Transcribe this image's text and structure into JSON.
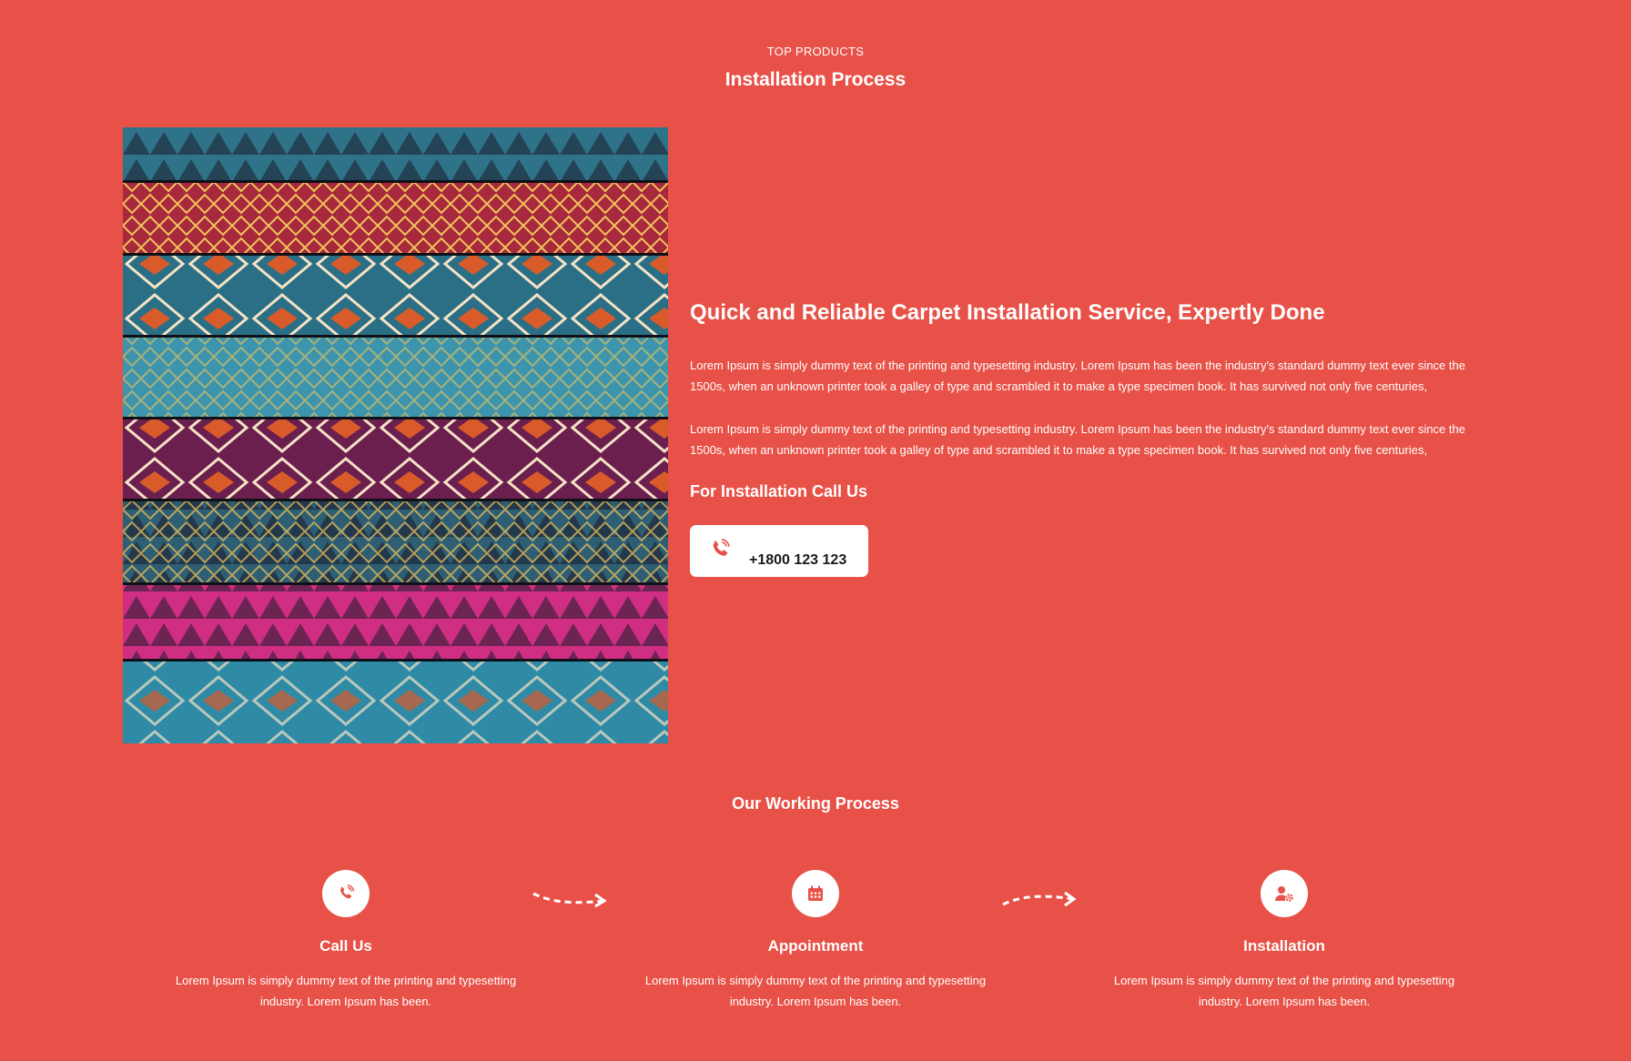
{
  "header": {
    "eyebrow": "TOP PRODUCTS",
    "title": "Installation Process"
  },
  "hero": {
    "image_alt": "stack of colorful patterned carpets",
    "headline": "Quick and Reliable Carpet Installation Service, Expertly Done",
    "paragraphs": [
      "Lorem Ipsum is simply dummy text of the printing and typesetting industry. Lorem Ipsum has been the industry's standard dummy text ever since the 1500s, when an unknown printer took a galley of type and scrambled it to make a type specimen book. It has survived not only five centuries,",
      "Lorem Ipsum is simply dummy text of the printing and typesetting industry. Lorem Ipsum has been the industry's standard dummy text ever since the 1500s, when an unknown printer took a galley of type and scrambled it to make a type specimen book. It has survived not only five centuries,"
    ],
    "call_title": "For Installation Call Us",
    "phone": "+1800 123 123",
    "phone_icon": "phone-icon"
  },
  "process": {
    "title": "Our Working Process",
    "steps": [
      {
        "icon": "phone-icon",
        "label": "Call Us",
        "desc": "Lorem Ipsum is simply dummy text of the printing and typesetting industry. Lorem Ipsum has been."
      },
      {
        "icon": "calendar-icon",
        "label": "Appointment",
        "desc": "Lorem Ipsum is simply dummy text of the printing and typesetting industry. Lorem Ipsum has been."
      },
      {
        "icon": "user-gear-icon",
        "label": "Installation",
        "desc": "Lorem Ipsum is simply dummy text of the printing and typesetting industry. Lorem Ipsum has been."
      }
    ]
  },
  "colors": {
    "background": "#e85147",
    "text": "#ffffff",
    "accent": "#e85147",
    "card": "#ffffff"
  }
}
